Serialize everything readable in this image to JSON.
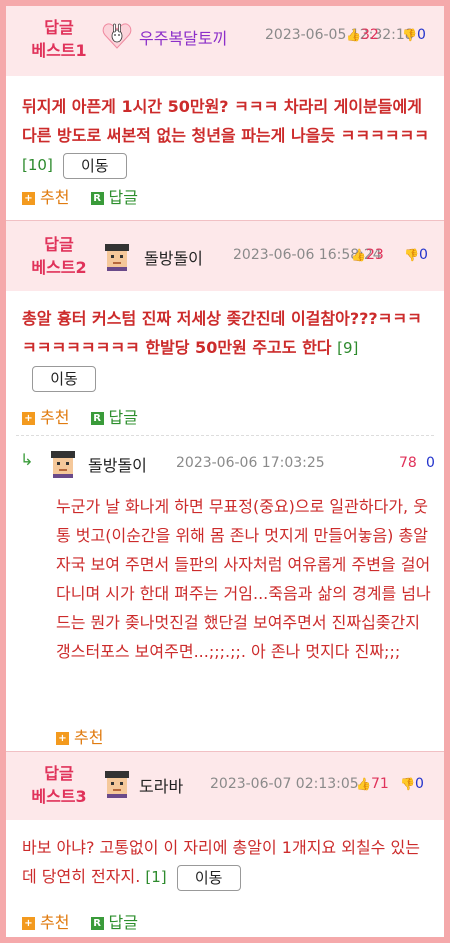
{
  "posts": [
    {
      "badge_line1": "답글",
      "badge_line2": "베스트1",
      "nickname": "우주복달토끼",
      "date": "2023-06-05 12:32:18",
      "up": "32",
      "down": "0",
      "body": "뒤지게 아픈게 1시간 50만원? ㅋㅋㅋ 차라리 게이분들에게 다른 방도로 써본적 없는 청년을 파는게 나을듯 ㅋㅋㅋㅋㅋㅋ",
      "count": "[10]",
      "move": "이동",
      "recommend": "추천",
      "reply": "답글"
    },
    {
      "badge_line1": "답글",
      "badge_line2": "베스트2",
      "nickname": "돌방돌이",
      "date": "2023-06-06 16:58:24",
      "up": "23",
      "down": "0",
      "body": "총알 흉터 커스텀 진짜 저세상 좆간진데 이걸참아???ㅋㅋㅋㅋㅋㅋㅋㅋㅋㅋㅋ 한발당 50만원 주고도 한다",
      "count": "[9]",
      "move": "이동",
      "recommend": "추천",
      "reply": "답글"
    },
    {
      "badge_line1": "답글",
      "badge_line2": "베스트3",
      "nickname": "도라바",
      "date": "2023-06-07 02:13:05",
      "up": "71",
      "down": "0",
      "body": "바보 아냐? 고통없이 이 자리에 총알이 1개지요 외칠수 있는데 당연히 전자지.",
      "count": "[1]",
      "move": "이동",
      "recommend": "추천",
      "reply": "답글"
    }
  ],
  "comment": {
    "nickname": "돌방돌이",
    "date": "2023-06-06 17:03:25",
    "up": "78",
    "down": "0",
    "body": "누군가 날 화나게 하면 무표정(중요)으로 일관하다가, 웃통 벗고(이순간을 위해 몸 존나 멋지게 만들어놓음) 총알 자국 보여 주면서 들판의 사자처럼 여유롭게 주변을 걸어다니며 시가 한대 펴주는 거임...죽음과 삶의 경계를 넘나드는 뭔가 좆나멋진걸 했단걸 보여주면서 진짜십좆간지갱스터포스 보여주면...;;;.;;. 아 존나 멋지다 진짜;;;",
    "recommend": "추천"
  },
  "colors": {
    "border": "#f5a9ab",
    "header_bg": "#fde8ea",
    "badge": "#e0325a",
    "body_text": "#cc2b2b",
    "down": "#2233cc",
    "reply_green": "#2d8f2d",
    "recommend_orange": "#e07b10"
  }
}
